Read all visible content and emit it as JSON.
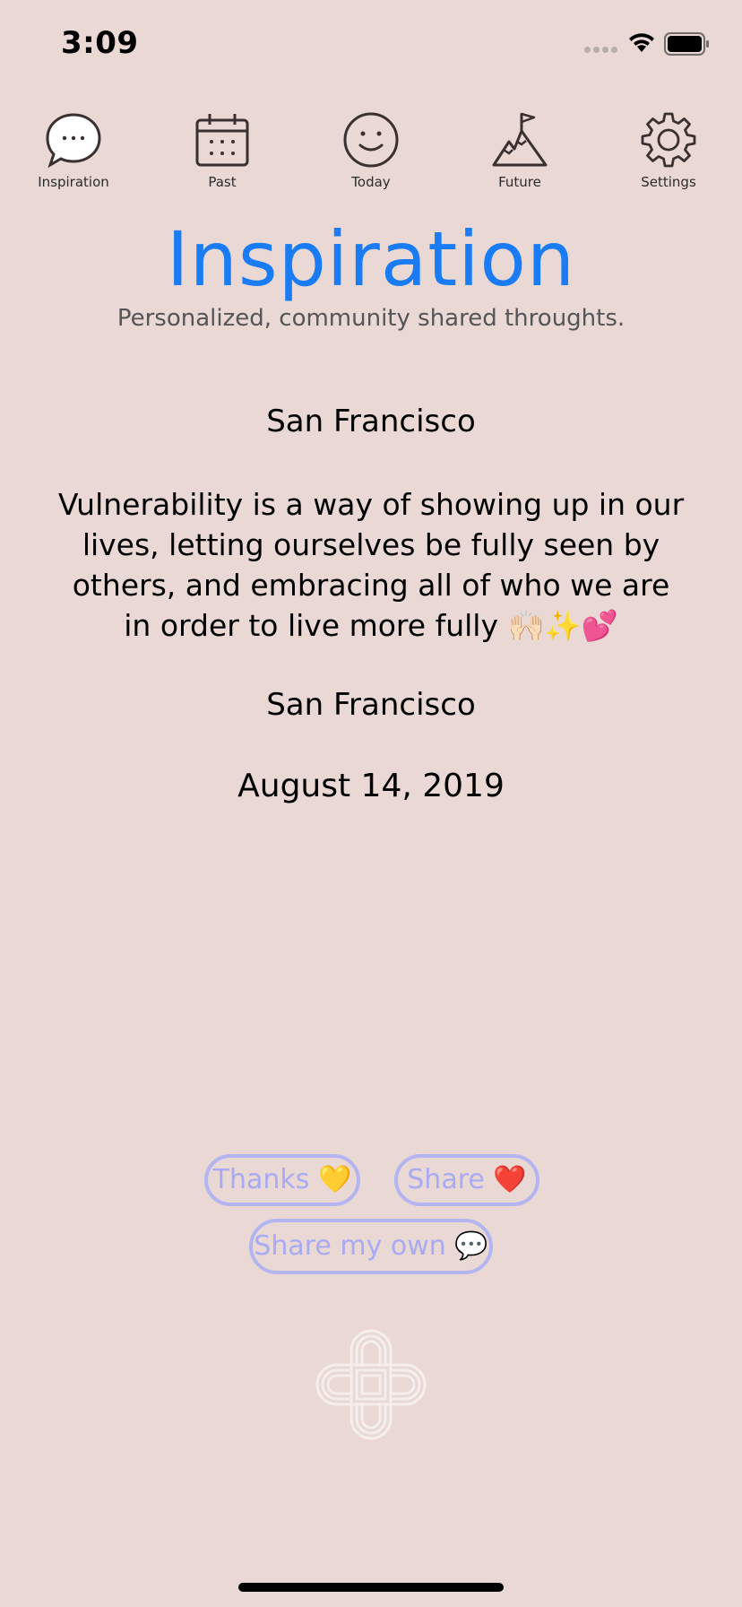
{
  "status_bar": {
    "time": "3:09",
    "icons": [
      "signal-dots-icon",
      "wifi-icon",
      "battery-icon"
    ]
  },
  "nav": {
    "items": [
      {
        "label": "Inspiration",
        "icon": "chat-bubble-icon"
      },
      {
        "label": "Past",
        "icon": "calendar-icon"
      },
      {
        "label": "Today",
        "icon": "smiley-icon"
      },
      {
        "label": "Future",
        "icon": "mountain-flag-icon"
      },
      {
        "label": "Settings",
        "icon": "gear-icon"
      }
    ]
  },
  "header": {
    "title": "Inspiration",
    "subtitle": "Personalized, community shared throughts."
  },
  "post": {
    "location_top": "San Francisco",
    "quote": "Vulnerability is a way of showing up in our lives, letting ourselves be fully seen by others, and embracing all of who we are in order to live more fully 🙌🏻✨💕",
    "location_bottom": "San Francisco",
    "date": "August 14, 2019"
  },
  "actions": {
    "thanks_label": "Thanks 💛",
    "share_label": "Share ❤️",
    "share_own_label": "Share my own 💬"
  },
  "logo": {
    "icon": "interlaced-knot-logo-icon"
  },
  "colors": {
    "background": "#e9d8d4",
    "title_blue": "#1a7cf5",
    "pill_border": "#b3b5f0",
    "pill_text": "#a9abf2"
  }
}
